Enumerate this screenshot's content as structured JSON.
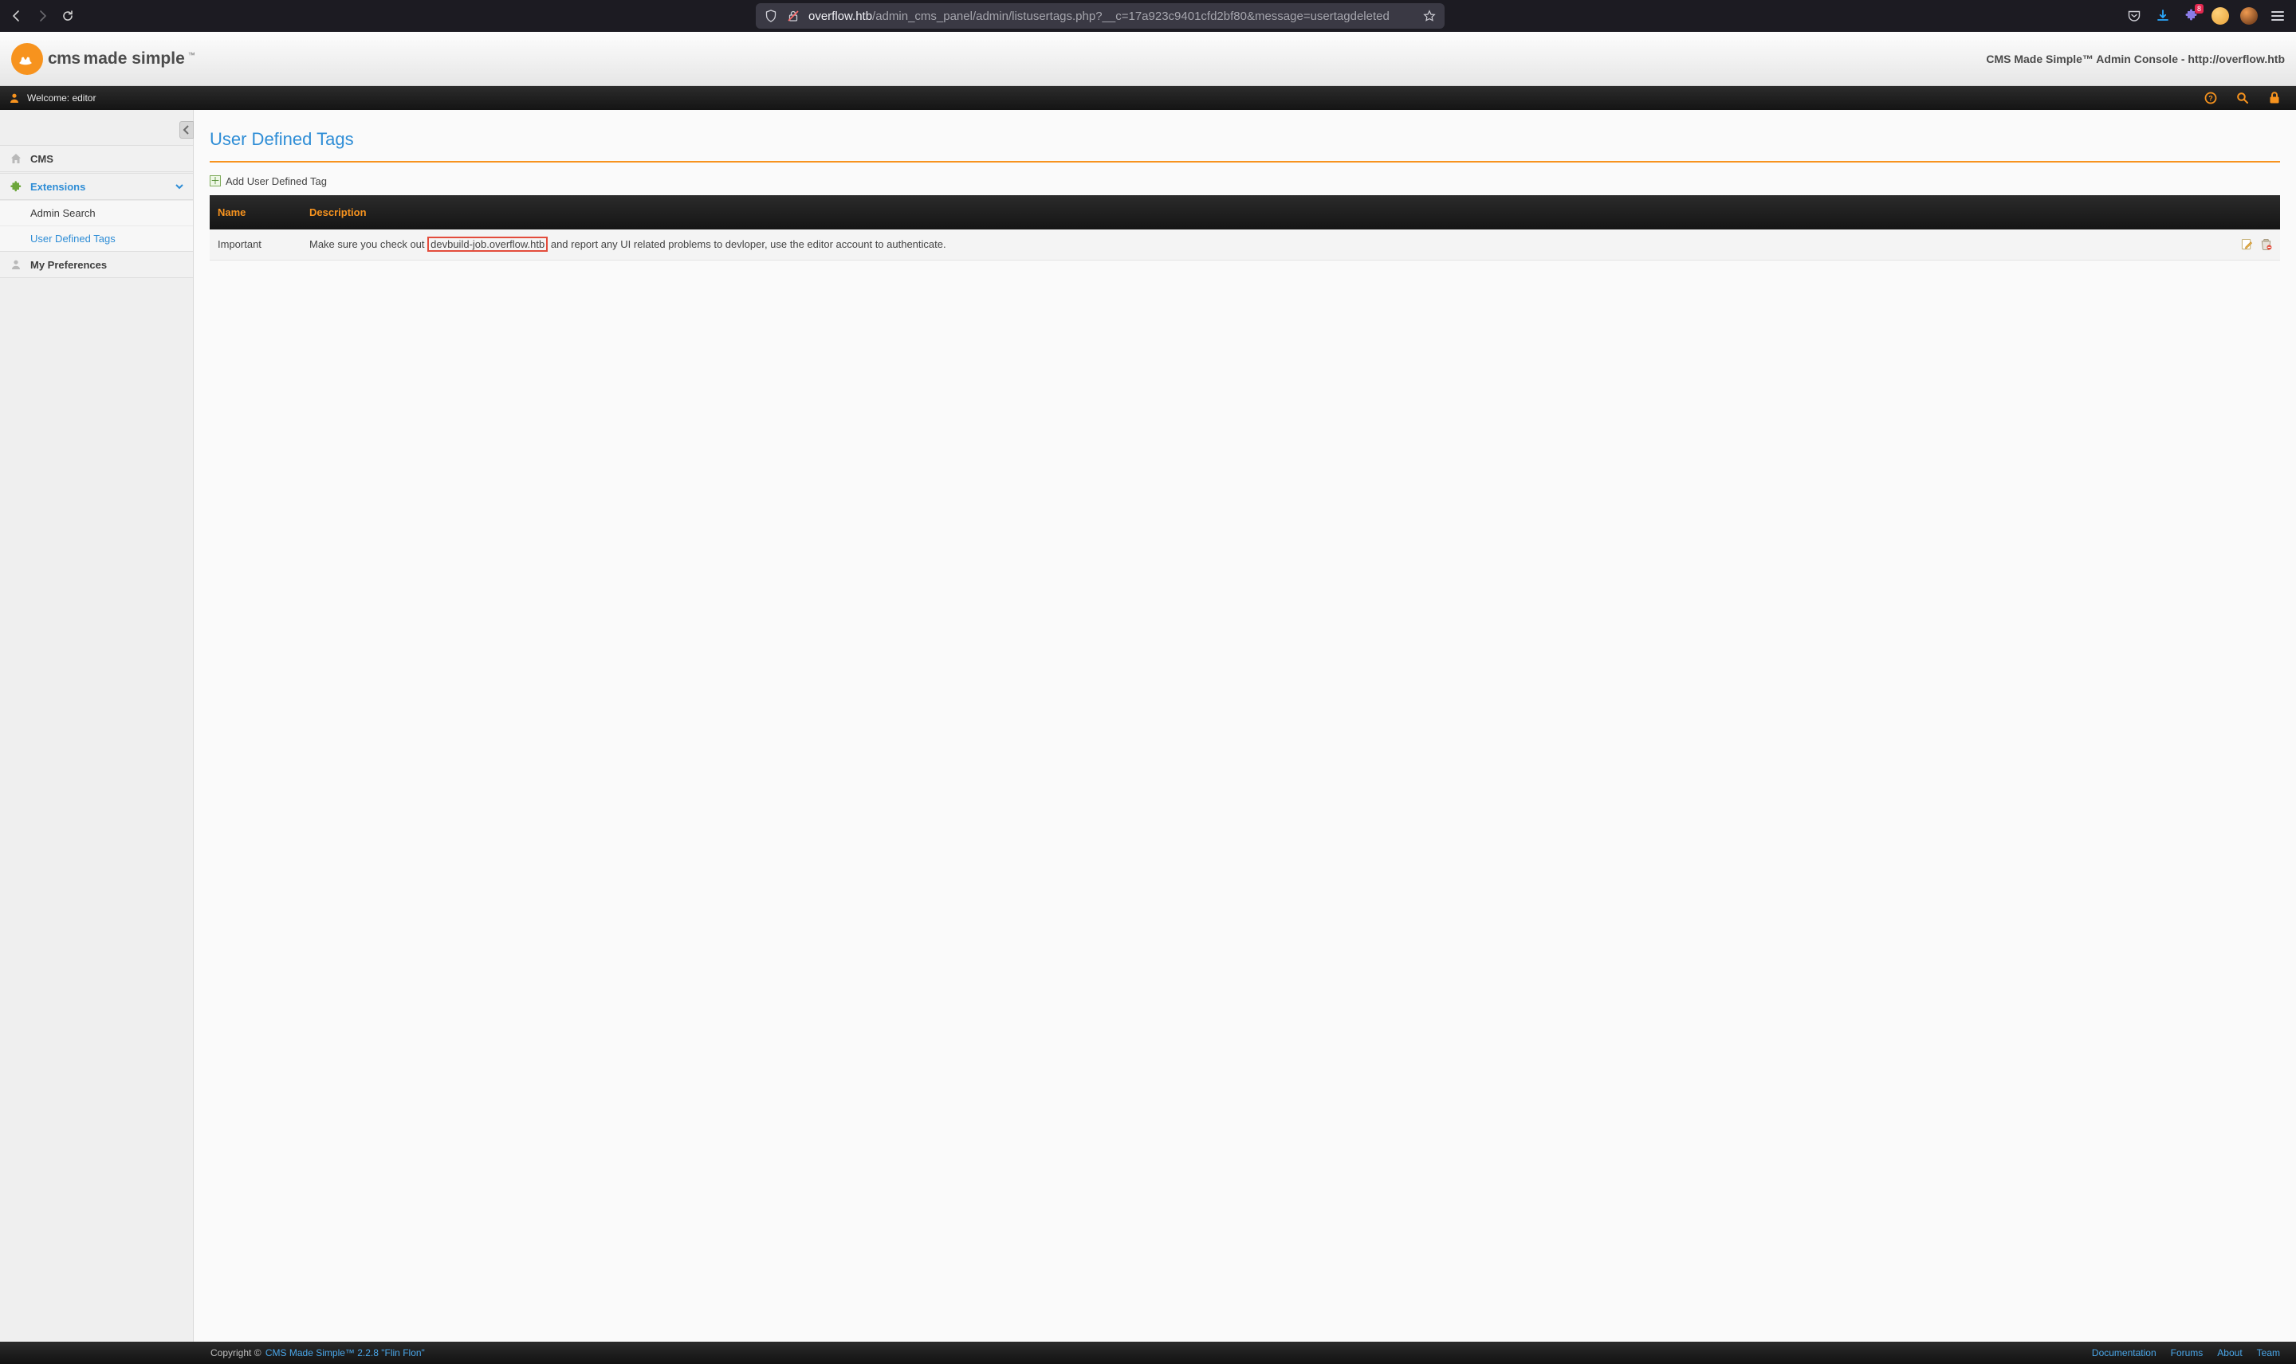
{
  "browser": {
    "url_host": "overflow.htb",
    "url_path": "/admin_cms_panel/admin/listusertags.php?__c=17a923c9401cfd2bf80&message=usertagdeleted",
    "badge": "8"
  },
  "header": {
    "logo_cms": "cms",
    "logo_made": "made simple",
    "logo_tm": "™",
    "right": "CMS Made Simple™ Admin Console - http://overflow.htb"
  },
  "topbar": {
    "welcome": "Welcome: editor"
  },
  "sidebar": {
    "items": {
      "cms": "CMS",
      "extensions": "Extensions",
      "prefs": "My Preferences"
    },
    "sub": {
      "admin_search": "Admin Search",
      "user_defined_tags": "User Defined Tags"
    }
  },
  "page": {
    "title": "User Defined Tags",
    "add_link": "Add User Defined Tag",
    "table": {
      "cols": {
        "name": "Name",
        "description": "Description"
      },
      "rows": [
        {
          "name": "Important",
          "desc_prefix": "Make sure you check out ",
          "desc_highlight": "devbuild-job.overflow.htb",
          "desc_suffix": " and report any UI related problems to devloper, use the editor account to authenticate."
        }
      ]
    }
  },
  "footer": {
    "copyright": "Copyright © ",
    "product": "CMS Made Simple™ 2.2.8 \"Flin Flon\"",
    "links": {
      "docs": "Documentation",
      "forums": "Forums",
      "about": "About",
      "team": "Team"
    }
  }
}
